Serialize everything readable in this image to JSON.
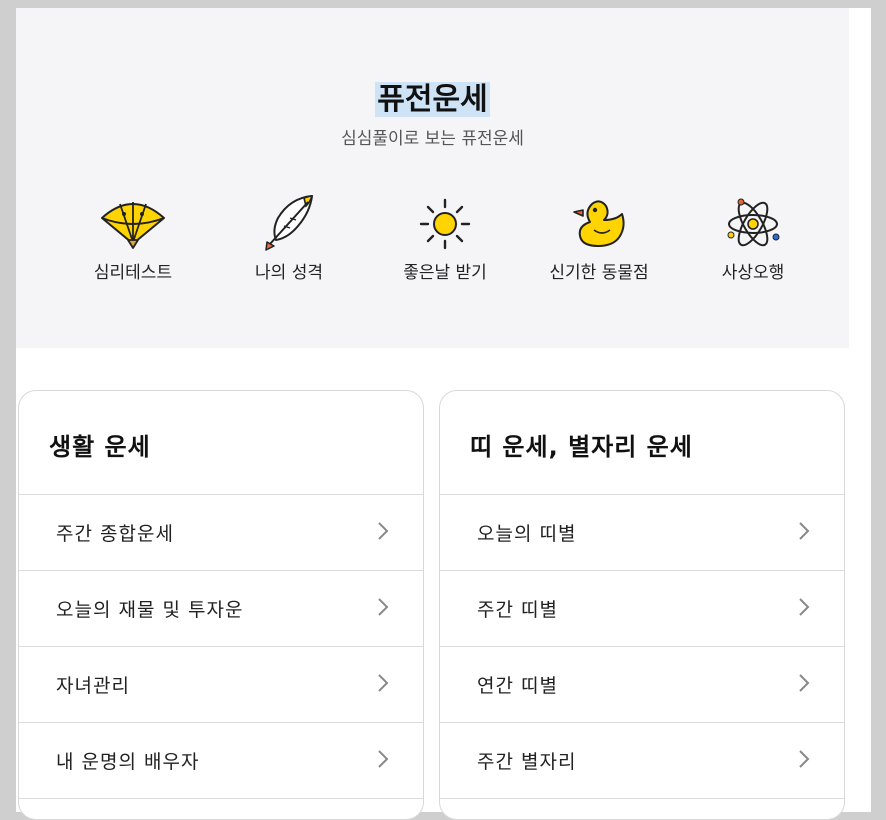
{
  "hero": {
    "title": "퓨전운세",
    "subtitle": "심심풀이로 보는 퓨전운세"
  },
  "categories": [
    {
      "label": "심리테스트",
      "icon": "folding-fan-icon"
    },
    {
      "label": "나의 성격",
      "icon": "feather-quill-icon"
    },
    {
      "label": "좋은날 받기",
      "icon": "sun-icon"
    },
    {
      "label": "신기한 동물점",
      "icon": "rubber-duck-icon"
    },
    {
      "label": "사상오행",
      "icon": "atom-icon"
    }
  ],
  "life_card": {
    "title": "생활 운세",
    "items": [
      {
        "label": "주간 종합운세"
      },
      {
        "label": "오늘의 재물 및 투자운"
      },
      {
        "label": "자녀관리"
      },
      {
        "label": "내 운명의 배우자"
      }
    ]
  },
  "zodiac_card": {
    "title": "띠 운세, 별자리 운세",
    "items": [
      {
        "label": "오늘의 띠별"
      },
      {
        "label": "주간 띠별"
      },
      {
        "label": "연간 띠별"
      },
      {
        "label": "주간 별자리"
      }
    ]
  },
  "colors": {
    "hero_background": "#f5f5f7",
    "accent_yellow": "#ffd400",
    "title_highlight": "#cfe3f7"
  }
}
